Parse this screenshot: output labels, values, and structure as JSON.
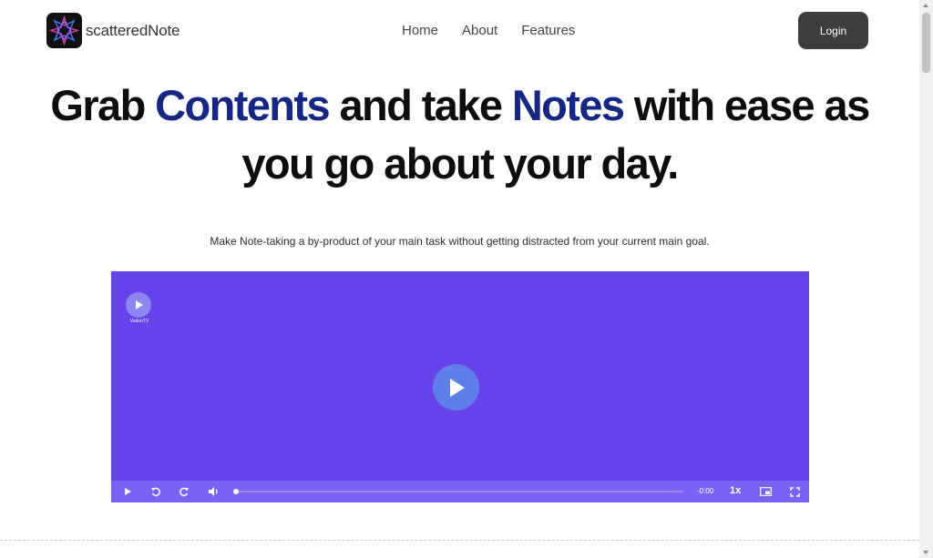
{
  "brand": {
    "name": "scatteredNote"
  },
  "nav": {
    "items": [
      {
        "label": "Home"
      },
      {
        "label": "About"
      },
      {
        "label": "Features"
      }
    ]
  },
  "header": {
    "login_label": "Login"
  },
  "hero": {
    "line1_pre": "Grab ",
    "line1_accent1": "Contents",
    "line1_mid": " and take ",
    "line1_accent2": "Notes",
    "line1_post": " with ease as",
    "line2": "you go about your day.",
    "subline": "Make Note-taking a by-product of your main task without getting distracted from your current main goal."
  },
  "video": {
    "brand_label": "VodeoTV",
    "time": "-0:00",
    "speed": "1x",
    "progress": 0,
    "icons": [
      "play-icon",
      "rewind-icon",
      "forward-icon",
      "volume-icon",
      "pip-icon",
      "fullscreen-icon"
    ]
  },
  "colors": {
    "accent": "#152783",
    "video_bg": "#6644e9",
    "controls_bg": "#7c62f4",
    "button_bg": "#3d3d3d"
  }
}
